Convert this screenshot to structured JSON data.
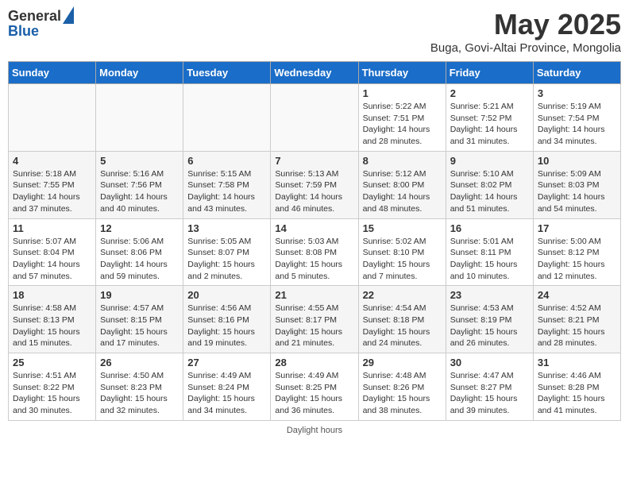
{
  "header": {
    "logo_general": "General",
    "logo_blue": "Blue",
    "month_title": "May 2025",
    "subtitle": "Buga, Govi-Altai Province, Mongolia"
  },
  "days_of_week": [
    "Sunday",
    "Monday",
    "Tuesday",
    "Wednesday",
    "Thursday",
    "Friday",
    "Saturday"
  ],
  "weeks": [
    [
      {
        "day": "",
        "info": ""
      },
      {
        "day": "",
        "info": ""
      },
      {
        "day": "",
        "info": ""
      },
      {
        "day": "",
        "info": ""
      },
      {
        "day": "1",
        "info": "Sunrise: 5:22 AM\nSunset: 7:51 PM\nDaylight: 14 hours and 28 minutes."
      },
      {
        "day": "2",
        "info": "Sunrise: 5:21 AM\nSunset: 7:52 PM\nDaylight: 14 hours and 31 minutes."
      },
      {
        "day": "3",
        "info": "Sunrise: 5:19 AM\nSunset: 7:54 PM\nDaylight: 14 hours and 34 minutes."
      }
    ],
    [
      {
        "day": "4",
        "info": "Sunrise: 5:18 AM\nSunset: 7:55 PM\nDaylight: 14 hours and 37 minutes."
      },
      {
        "day": "5",
        "info": "Sunrise: 5:16 AM\nSunset: 7:56 PM\nDaylight: 14 hours and 40 minutes."
      },
      {
        "day": "6",
        "info": "Sunrise: 5:15 AM\nSunset: 7:58 PM\nDaylight: 14 hours and 43 minutes."
      },
      {
        "day": "7",
        "info": "Sunrise: 5:13 AM\nSunset: 7:59 PM\nDaylight: 14 hours and 46 minutes."
      },
      {
        "day": "8",
        "info": "Sunrise: 5:12 AM\nSunset: 8:00 PM\nDaylight: 14 hours and 48 minutes."
      },
      {
        "day": "9",
        "info": "Sunrise: 5:10 AM\nSunset: 8:02 PM\nDaylight: 14 hours and 51 minutes."
      },
      {
        "day": "10",
        "info": "Sunrise: 5:09 AM\nSunset: 8:03 PM\nDaylight: 14 hours and 54 minutes."
      }
    ],
    [
      {
        "day": "11",
        "info": "Sunrise: 5:07 AM\nSunset: 8:04 PM\nDaylight: 14 hours and 57 minutes."
      },
      {
        "day": "12",
        "info": "Sunrise: 5:06 AM\nSunset: 8:06 PM\nDaylight: 14 hours and 59 minutes."
      },
      {
        "day": "13",
        "info": "Sunrise: 5:05 AM\nSunset: 8:07 PM\nDaylight: 15 hours and 2 minutes."
      },
      {
        "day": "14",
        "info": "Sunrise: 5:03 AM\nSunset: 8:08 PM\nDaylight: 15 hours and 5 minutes."
      },
      {
        "day": "15",
        "info": "Sunrise: 5:02 AM\nSunset: 8:10 PM\nDaylight: 15 hours and 7 minutes."
      },
      {
        "day": "16",
        "info": "Sunrise: 5:01 AM\nSunset: 8:11 PM\nDaylight: 15 hours and 10 minutes."
      },
      {
        "day": "17",
        "info": "Sunrise: 5:00 AM\nSunset: 8:12 PM\nDaylight: 15 hours and 12 minutes."
      }
    ],
    [
      {
        "day": "18",
        "info": "Sunrise: 4:58 AM\nSunset: 8:13 PM\nDaylight: 15 hours and 15 minutes."
      },
      {
        "day": "19",
        "info": "Sunrise: 4:57 AM\nSunset: 8:15 PM\nDaylight: 15 hours and 17 minutes."
      },
      {
        "day": "20",
        "info": "Sunrise: 4:56 AM\nSunset: 8:16 PM\nDaylight: 15 hours and 19 minutes."
      },
      {
        "day": "21",
        "info": "Sunrise: 4:55 AM\nSunset: 8:17 PM\nDaylight: 15 hours and 21 minutes."
      },
      {
        "day": "22",
        "info": "Sunrise: 4:54 AM\nSunset: 8:18 PM\nDaylight: 15 hours and 24 minutes."
      },
      {
        "day": "23",
        "info": "Sunrise: 4:53 AM\nSunset: 8:19 PM\nDaylight: 15 hours and 26 minutes."
      },
      {
        "day": "24",
        "info": "Sunrise: 4:52 AM\nSunset: 8:21 PM\nDaylight: 15 hours and 28 minutes."
      }
    ],
    [
      {
        "day": "25",
        "info": "Sunrise: 4:51 AM\nSunset: 8:22 PM\nDaylight: 15 hours and 30 minutes."
      },
      {
        "day": "26",
        "info": "Sunrise: 4:50 AM\nSunset: 8:23 PM\nDaylight: 15 hours and 32 minutes."
      },
      {
        "day": "27",
        "info": "Sunrise: 4:49 AM\nSunset: 8:24 PM\nDaylight: 15 hours and 34 minutes."
      },
      {
        "day": "28",
        "info": "Sunrise: 4:49 AM\nSunset: 8:25 PM\nDaylight: 15 hours and 36 minutes."
      },
      {
        "day": "29",
        "info": "Sunrise: 4:48 AM\nSunset: 8:26 PM\nDaylight: 15 hours and 38 minutes."
      },
      {
        "day": "30",
        "info": "Sunrise: 4:47 AM\nSunset: 8:27 PM\nDaylight: 15 hours and 39 minutes."
      },
      {
        "day": "31",
        "info": "Sunrise: 4:46 AM\nSunset: 8:28 PM\nDaylight: 15 hours and 41 minutes."
      }
    ]
  ],
  "footer": "Daylight hours"
}
